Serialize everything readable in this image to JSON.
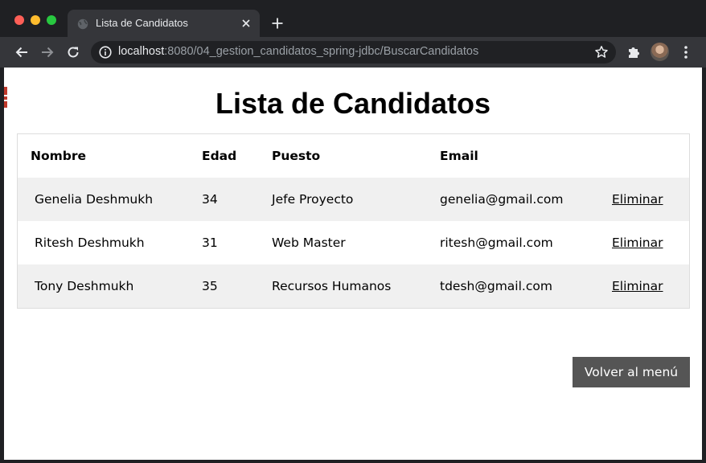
{
  "browser": {
    "tab_title": "Lista de Candidatos",
    "url_host": "localhost",
    "url_path": ":8080/04_gestion_candidatos_spring-jdbc/BuscarCandidatos"
  },
  "page": {
    "title": "Lista de Candidatos",
    "table": {
      "headers": {
        "nombre": "Nombre",
        "edad": "Edad",
        "puesto": "Puesto",
        "email": "Email"
      },
      "rows": [
        {
          "nombre": "Genelia Deshmukh",
          "edad": "34",
          "puesto": "Jefe Proyecto",
          "email": "genelia@gmail.com",
          "action": "Eliminar"
        },
        {
          "nombre": "Ritesh Deshmukh",
          "edad": "31",
          "puesto": "Web Master",
          "email": "ritesh@gmail.com",
          "action": "Eliminar"
        },
        {
          "nombre": "Tony Deshmukh",
          "edad": "35",
          "puesto": "Recursos Humanos",
          "email": "tdesh@gmail.com",
          "action": "Eliminar"
        }
      ]
    },
    "back_button": "Volver al menú"
  },
  "colors": {
    "button_bg": "#555555",
    "row_alt_bg": "#f0f0f0",
    "table_border": "#dddddd"
  }
}
